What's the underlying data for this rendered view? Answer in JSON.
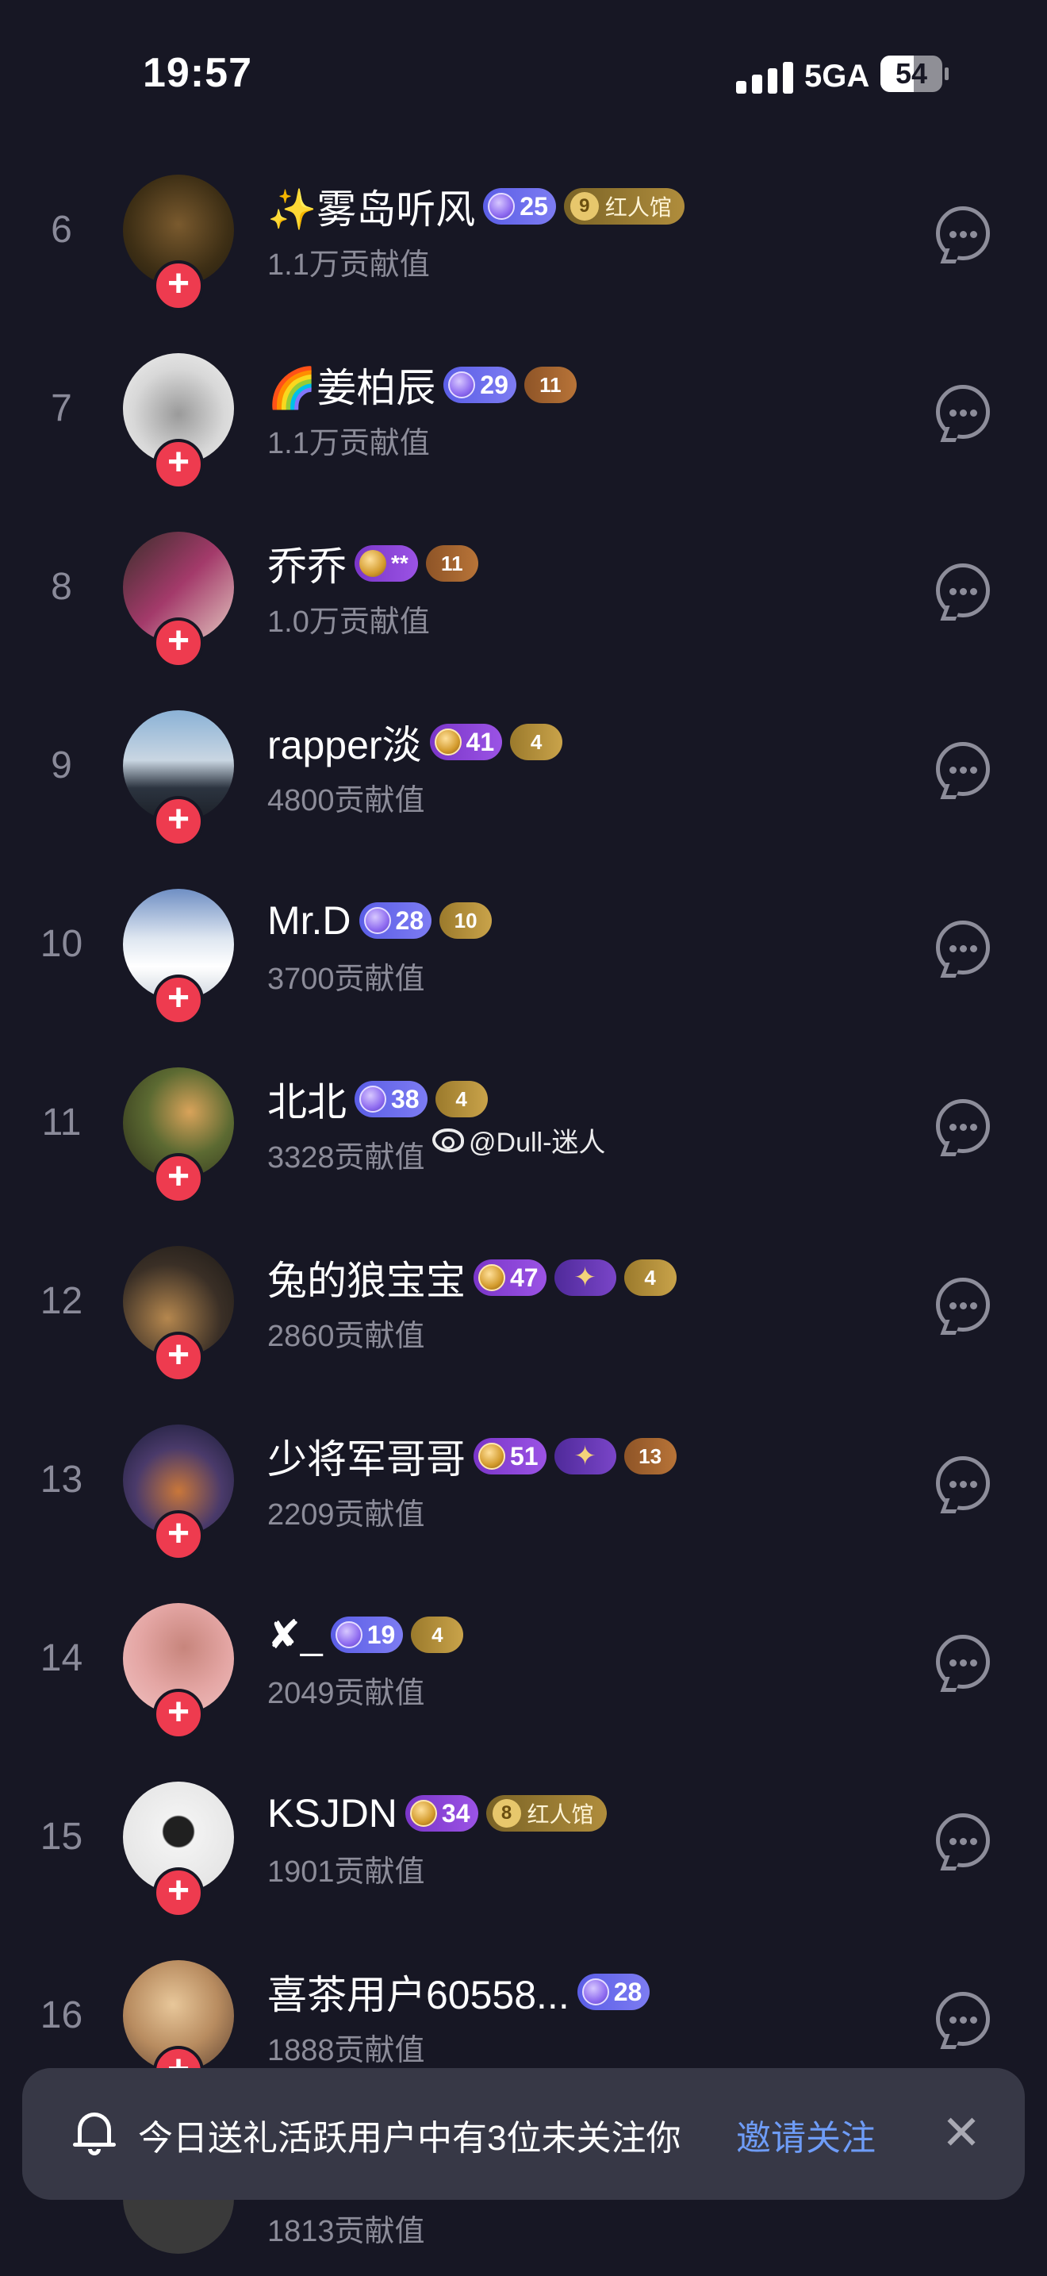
{
  "status_bar": {
    "time": "19:57",
    "network": "5GA",
    "battery": "54",
    "battery_level": 0.54
  },
  "contribution_suffix": "贡献值",
  "rows": [
    {
      "rank": "6",
      "name": "✨雾岛听风",
      "score": "1.1万贡献值",
      "level": "25",
      "hall_badge": {
        "num": "9",
        "label": "红人馆"
      }
    },
    {
      "rank": "7",
      "name": "🌈姜柏辰",
      "score": "1.1万贡献值",
      "level": "29",
      "heart": "11"
    },
    {
      "rank": "8",
      "name": "乔乔",
      "score": "1.0万贡献值",
      "stars": "**",
      "heart": "11"
    },
    {
      "rank": "9",
      "name": "rapper淡",
      "score": "4800贡献值",
      "level": "41",
      "heart": "4"
    },
    {
      "rank": "10",
      "name": "Mr.D",
      "score": "3700贡献值",
      "level": "28",
      "heart": "10"
    },
    {
      "rank": "11",
      "name": "北北",
      "score": "3328贡献值",
      "level": "38",
      "heart": "4"
    },
    {
      "rank": "12",
      "name": "兔的狼宝宝",
      "score": "2860贡献值",
      "level": "47",
      "heart": "4"
    },
    {
      "rank": "13",
      "name": "少将军哥哥",
      "score": "2209贡献值",
      "level": "51",
      "heart": "13"
    },
    {
      "rank": "14",
      "name": "✘_",
      "score": "2049贡献值",
      "level": "19",
      "heart": "4"
    },
    {
      "rank": "15",
      "name": "KSJDN",
      "score": "1901贡献值",
      "level": "34",
      "hall_badge": {
        "num": "8",
        "label": "红人馆"
      }
    },
    {
      "rank": "16",
      "name": "喜茶用户60558...",
      "score": "1888贡献值",
      "level": "28"
    }
  ],
  "partial_row": {
    "score": "1813贡献值"
  },
  "watermark": "@Dull-迷人",
  "toast": {
    "text": "今日送礼活跃用户中有3位未关注你",
    "link": "邀请关注",
    "close": "✕"
  },
  "colors": {
    "background": "#171724",
    "follow": "#ee3b4f",
    "link": "#6e9cf7",
    "toast_bg": "#373846"
  },
  "icons": [
    "signal-icon",
    "battery-icon",
    "chat-bubble-icon",
    "follow-plus-icon",
    "bell-icon",
    "close-icon",
    "weibo-icon"
  ]
}
